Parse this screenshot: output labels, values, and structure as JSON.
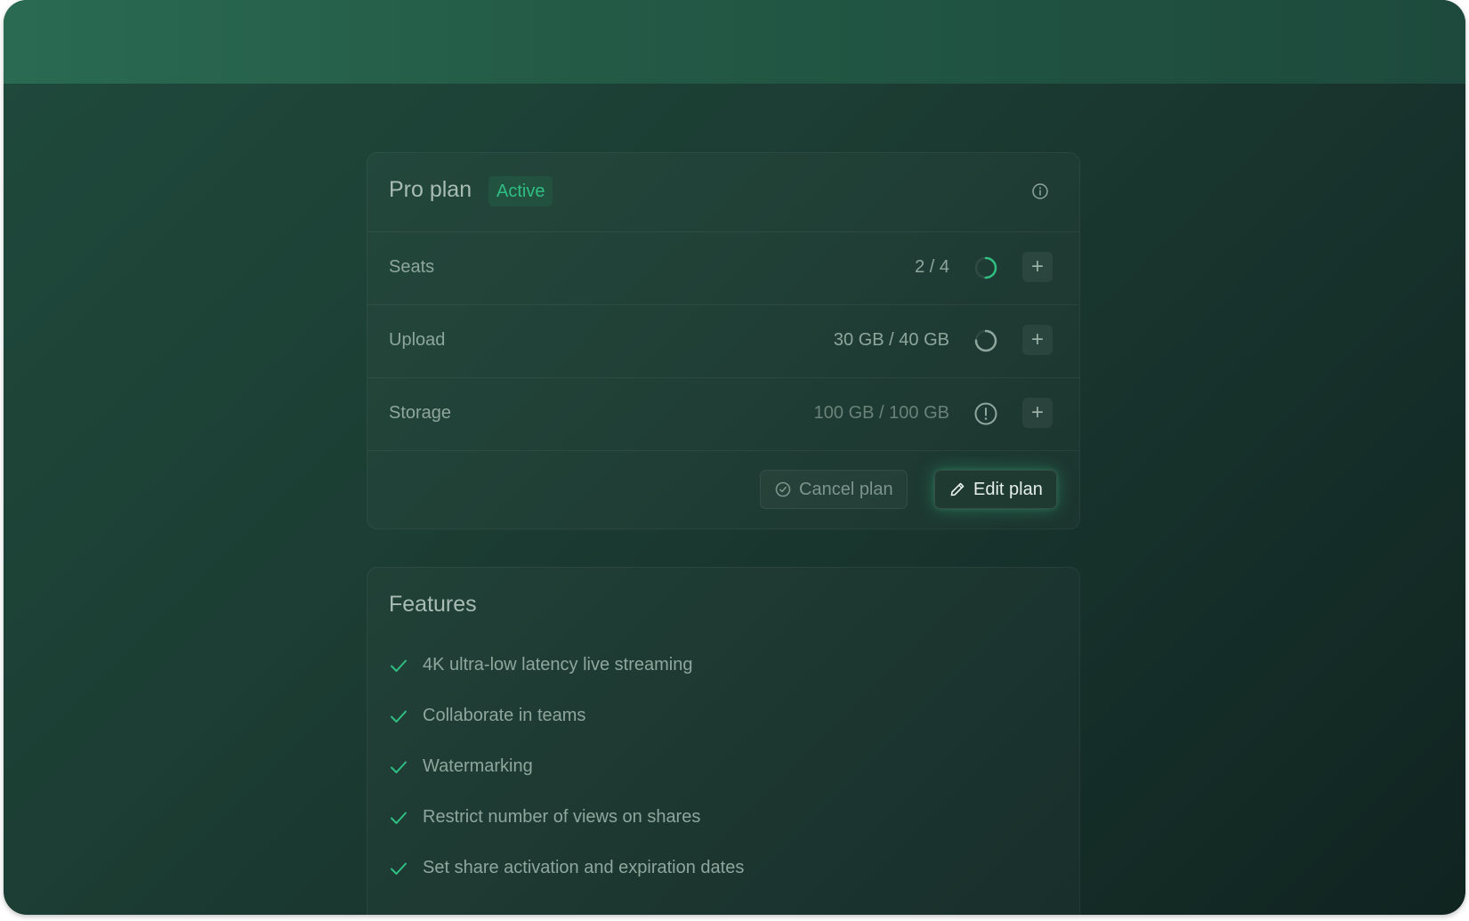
{
  "plan": {
    "title": "Pro plan",
    "status_badge": "Active",
    "rows": [
      {
        "label": "Seats",
        "value": "2 / 4",
        "usage": 0.5
      },
      {
        "label": "Upload",
        "value": "30 GB / 40 GB",
        "usage": 0.75
      },
      {
        "label": "Storage",
        "value": "100 GB / 100 GB",
        "usage": 1.0
      }
    ],
    "cancel_label": "Cancel plan",
    "edit_label": "Edit plan",
    "add_label": "+"
  },
  "features": {
    "title": "Features",
    "items": [
      "4K ultra-low latency live streaming",
      "Collaborate in teams",
      "Watermarking",
      "Restrict number of views on shares",
      "Set share activation and expiration dates"
    ]
  },
  "colors": {
    "accent": "#2fbf83",
    "background": "#1c3d33",
    "topbar": "#2a6a52"
  },
  "icons": {
    "info": "info-icon",
    "seats_progress": "progress-ring-icon",
    "upload_progress": "progress-ring-icon",
    "storage_warning": "warning-icon",
    "cancel": "cancel-icon",
    "edit": "pencil-icon",
    "check": "check-icon",
    "plus": "plus-icon"
  }
}
